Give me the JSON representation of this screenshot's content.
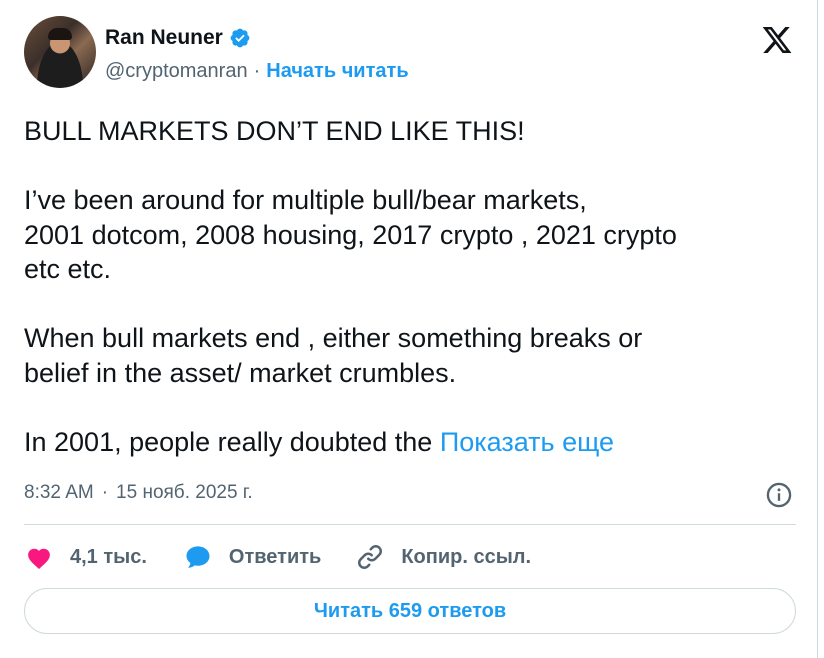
{
  "author": {
    "name": "Ran Neuner",
    "handle": "@cryptomanran",
    "separator": "·",
    "follow_label": "Начать читать"
  },
  "tweet": {
    "text": "BULL MARKETS DON’T END LIKE THIS!\n\nI’ve been around for multiple bull/bear markets,\n2001 dotcom, 2008 housing, 2017 crypto , 2021 crypto\netc etc.\n\nWhen bull markets end , either something breaks or\nbelief in the asset/ market crumbles.\n\nIn 2001, people really doubted the ",
    "show_more_label": "Показать еще"
  },
  "meta": {
    "time": "8:32 AM",
    "separator": "·",
    "date": "15 нояб. 2025 г."
  },
  "actions": {
    "likes": "4,1 тыс.",
    "reply_label": "Ответить",
    "copy_link_label": "Копир. ссыл."
  },
  "read_replies_label": "Читать 659 ответов",
  "colors": {
    "accent": "#1d9bf0",
    "like": "#f91880",
    "text": "#0f1419",
    "muted": "#536471",
    "border": "#cfd9de"
  },
  "icons": [
    "verified-badge-icon",
    "x-logo-icon",
    "info-icon",
    "heart-icon",
    "reply-bubble-icon",
    "link-icon"
  ]
}
